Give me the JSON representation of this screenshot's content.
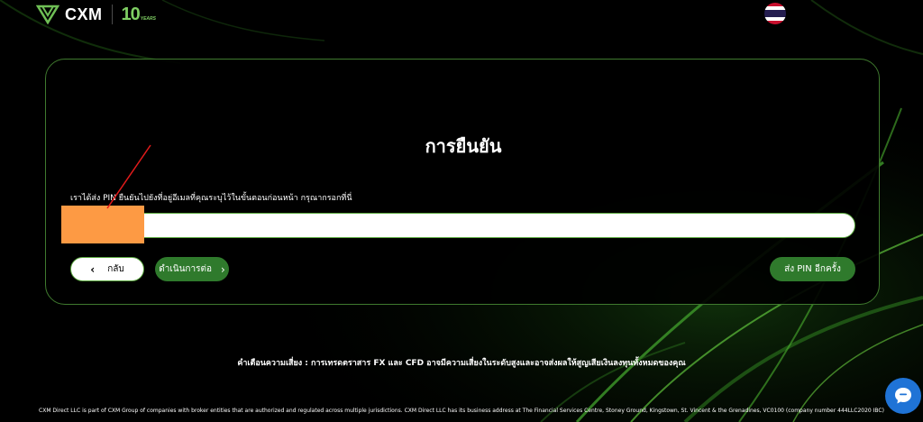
{
  "brand": {
    "name": "CXM",
    "anniversary_number": "10",
    "anniversary_word": "YEARS"
  },
  "language": {
    "flag": "thailand-flag-icon"
  },
  "card": {
    "title": "การยืนยัน",
    "label": "เราได้ส่ง PIN ยืนยันไปยังที่อยู่อีเมลที่คุณระบุไว้ในขั้นตอนก่อนหน้า กรุณากรอกที่นี่",
    "pin_value": "",
    "back_label": "กลับ",
    "continue_label": "ดำเนินการต่อ",
    "resend_label": "ส่ง PIN อีกครั้ง"
  },
  "footer": {
    "risk_warning": "คำเตือนความเสี่ยง : การเทรดตราสาร FX และ CFD อาจมีความเสี่ยงในระดับสูงและอาจส่งผลให้สูญเสียเงินลงทุนทั้งหมดของคุณ",
    "legal": "CXM Direct LLC is part of CXM Group of companies with broker entities that are authorized and regulated across multiple jurisdictions. CXM Direct LLC has its business address at The Financial Services Centre, Stoney Ground, Kingstown, St. Vincent & the Grenadines, VC0100   (company number 444LLC2020 IBC)"
  },
  "colors": {
    "accent_green": "#2f7a2c",
    "border_green": "#5aa83e",
    "redaction_orange": "#fd9a44",
    "chat_blue": "#1f73d6"
  }
}
